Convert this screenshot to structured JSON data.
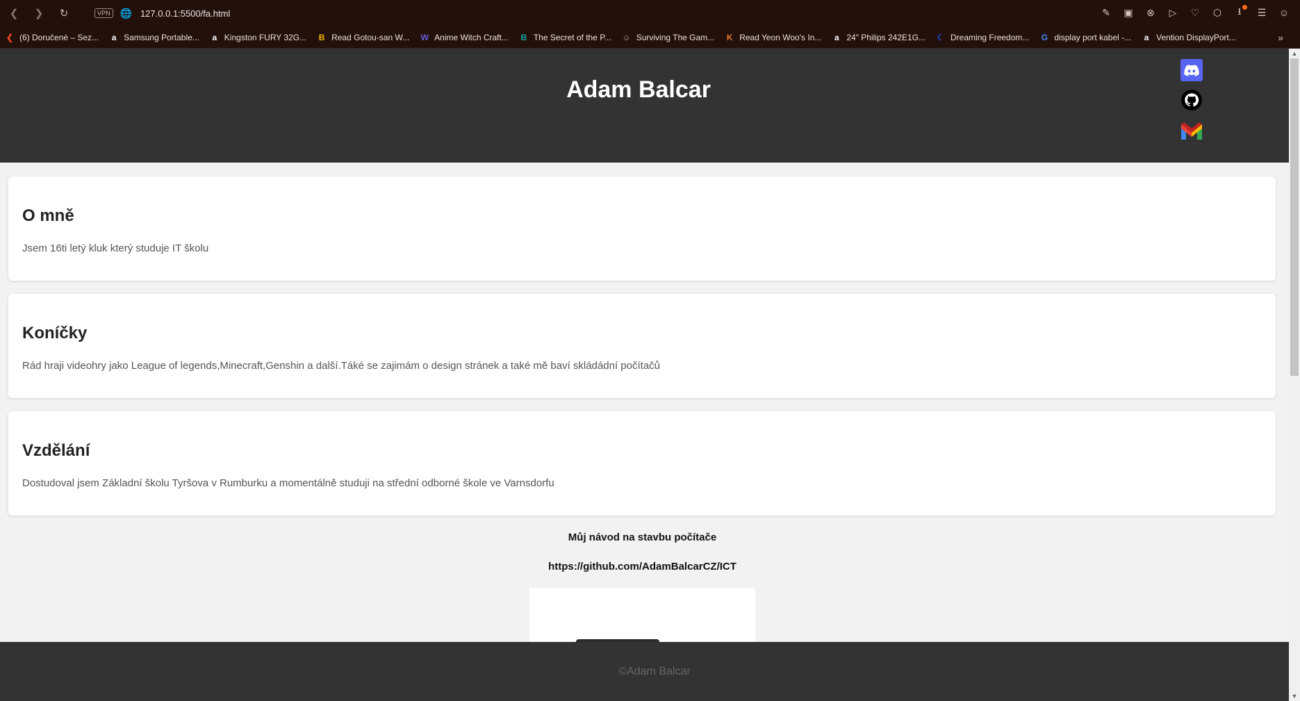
{
  "browser": {
    "url": "127.0.0.1:5500/fa.html",
    "vpn_label": "VPN",
    "bookmarks": [
      {
        "label": "(6) Doručené – Sez...",
        "icon": "seznam-icon",
        "color": "#e8471e"
      },
      {
        "label": "Samsung Portable...",
        "icon": "amazon-icon",
        "color": "#ffffff"
      },
      {
        "label": "Kingston FURY 32G...",
        "icon": "amazon-icon",
        "color": "#ffffff"
      },
      {
        "label": "Read Gotou-san W...",
        "icon": "b-icon",
        "color": "#f5b800"
      },
      {
        "label": "Anime Witch Craft...",
        "icon": "w-icon",
        "color": "#6b5bd6"
      },
      {
        "label": "The Secret of the P...",
        "icon": "b-square-icon",
        "color": "#1aa6a6"
      },
      {
        "label": "Surviving The Gam...",
        "icon": "face-icon",
        "color": "#a89a92"
      },
      {
        "label": "Read Yeon Woo's In...",
        "icon": "k-icon",
        "color": "#f07a2a"
      },
      {
        "label": "24\" Philips 242E1G...",
        "icon": "amazon-icon",
        "color": "#ffffff"
      },
      {
        "label": "Dreaming Freedom...",
        "icon": "moon-icon",
        "color": "#2946c7"
      },
      {
        "label": "display port kabel -...",
        "icon": "google-icon",
        "color": "#4285f4"
      },
      {
        "label": "Vention DisplayPort...",
        "icon": "amazon-icon",
        "color": "#ffffff"
      }
    ],
    "more_label": "»"
  },
  "header": {
    "title": "Adam Balcar"
  },
  "sections": [
    {
      "heading": "O mně",
      "text": "Jsem 16ti letý kluk který studuje IT školu"
    },
    {
      "heading": "Koníčky",
      "text": "Rád hraji videohry jako League of legends,Minecraft,Genshin a další.Táké se zajimám o design stránek a také mě baví skládádní počítačů"
    },
    {
      "heading": "Vzdělání",
      "text": "Dostudoval jsem Základní školu Tyršova v Rumburku a momentálně studuji na střední odborné škole ve Varnsdorfu"
    }
  ],
  "guide": {
    "title": "Můj návod na stavbu počítače",
    "link": "https://github.com/AdamBalcarCZ/ICT"
  },
  "footer": {
    "text": "©Adam Balcar"
  },
  "colors": {
    "header_bg": "#333333",
    "discord": "#5865f2",
    "browser_bg": "#22100b"
  }
}
